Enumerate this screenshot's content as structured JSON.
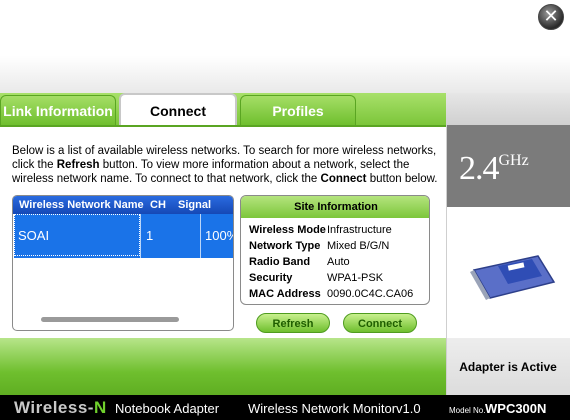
{
  "window": {
    "close_glyph": "✕"
  },
  "tabs": [
    {
      "label": "Link Information",
      "active": false
    },
    {
      "label": "Connect",
      "active": true
    },
    {
      "label": "Profiles",
      "active": false
    }
  ],
  "description": {
    "part1": "Below is a list of available wireless networks. To search for more wireless networks, click the ",
    "refresh_word": "Refresh",
    "part2": " button. To view more information about a network, select the wireless network name. To connect to that network, click the ",
    "connect_word": "Connect",
    "part3": " button below."
  },
  "network_list": {
    "columns": [
      "Wireless Network Name",
      "CH",
      "Signal"
    ],
    "rows": [
      {
        "name": "SOAI",
        "ch": "1",
        "signal": "100%",
        "selected": true
      }
    ]
  },
  "site_information": {
    "title": "Site Information",
    "fields": [
      {
        "label": "Wireless Mode",
        "value": "Infrastructure"
      },
      {
        "label": "Network Type",
        "value": "Mixed B/G/N"
      },
      {
        "label": "Radio Band",
        "value": "Auto"
      },
      {
        "label": "Security",
        "value": "WPA1-PSK"
      },
      {
        "label": "MAC Address",
        "value": "0090.0C4C.CA06"
      }
    ]
  },
  "buttons": {
    "refresh": "Refresh",
    "connect": "Connect"
  },
  "band": {
    "number": "2.4",
    "unit": "GHz"
  },
  "status": {
    "text": "Adapter is Active"
  },
  "footer": {
    "brand_prefix": "Wireless-",
    "brand_n": "N",
    "product": "Notebook Adapter",
    "monitor": "Wireless Network Monitor",
    "version": "v1.0",
    "model_label": "Model No.",
    "model": "WPC300N"
  },
  "colors": {
    "accent_green": "#7cc63a",
    "selection_blue": "#1a73e8",
    "header_blue": "#1b57c8",
    "brand_n_green": "#6fd02c"
  }
}
